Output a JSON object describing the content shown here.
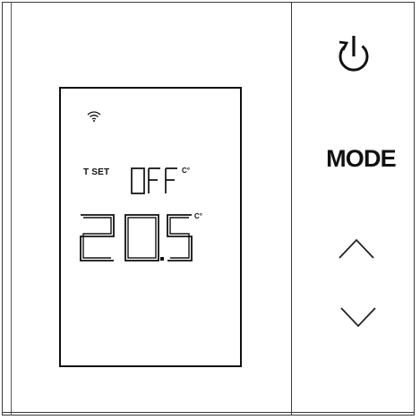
{
  "display": {
    "set_label": "T SET",
    "set_value": "OFF",
    "current_temperature": "20.5",
    "unit": "C°"
  },
  "buttons": {
    "mode_label": "MODE"
  },
  "icons": {
    "wifi": "wifi-icon",
    "power": "power-icon",
    "up": "chevron-up-icon",
    "down": "chevron-down-icon"
  }
}
